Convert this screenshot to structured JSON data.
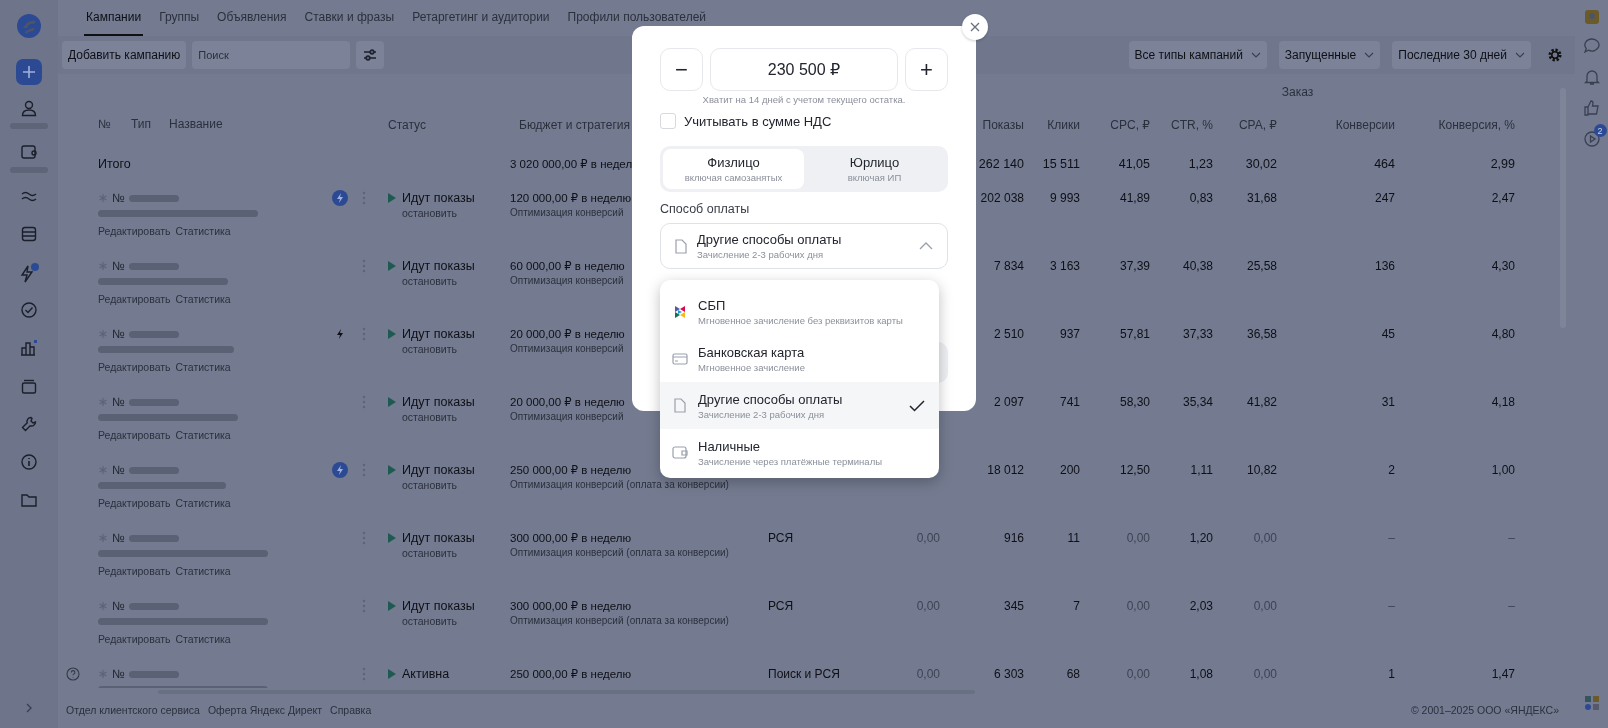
{
  "tabs": [
    {
      "label": "Кампании",
      "selected": true
    },
    {
      "label": "Группы",
      "selected": false
    },
    {
      "label": "Объявления",
      "selected": false
    },
    {
      "label": "Ставки и фразы",
      "selected": false
    },
    {
      "label": "Ретаргетинг и аудитории",
      "selected": false
    },
    {
      "label": "Профили пользователей",
      "selected": false
    }
  ],
  "toolbar": {
    "add_button": "Добавить кампанию",
    "search": {
      "placeholder": "Поиск"
    },
    "filters": [
      "Все типы кампаний",
      "Запущенные",
      "Последние 30 дней"
    ]
  },
  "table": {
    "group_header": "Заказ",
    "name_columns": [
      "№",
      "Тип",
      "Название"
    ],
    "status_column": "Статус",
    "budget_column": "Бюджет и стратегия",
    "metric_columns": [
      "Показы",
      "Клики",
      "CPC, ₽",
      "CTR, %",
      "CPA, ₽",
      "Конверсии",
      "Конверсия, %"
    ],
    "total": {
      "label": "Итого",
      "budget": "3 020 000,00 ₽ в недел",
      "metrics": [
        {
          "text": "262 140",
          "dim": false
        },
        {
          "text": "15 511",
          "dim": false
        },
        {
          "text": "41,05",
          "dim": false
        },
        {
          "text": "1,23",
          "dim": false
        },
        {
          "text": "30,02",
          "dim": false
        },
        {
          "text": "464",
          "dim": false
        },
        {
          "text": "2,99",
          "dim": false
        }
      ]
    },
    "rows": [
      {
        "number": "№",
        "boost": {
          "kind": "filled"
        },
        "help": false,
        "status": "Идут показы",
        "stop": "остановить",
        "budget": "120 000,00 ₽ в неделю",
        "strategy": "Оптимизация конверсий",
        "links": [
          "Редактировать",
          "Статистика"
        ],
        "metrics": [
          {
            "text": "202 038",
            "dim": false
          },
          {
            "text": "9 993",
            "dim": false
          },
          {
            "text": "41,89",
            "dim": false
          },
          {
            "text": "0,83",
            "dim": false
          },
          {
            "text": "31,68",
            "dim": false
          },
          {
            "text": "247",
            "dim": false
          },
          {
            "text": "2,47",
            "dim": false
          }
        ]
      },
      {
        "number": "№",
        "help": false,
        "status": "Идут показы",
        "stop": "остановить",
        "budget": "60 000,00 ₽ в неделю",
        "strategy": "Оптимизация конверсий",
        "links": [
          "Редактировать",
          "Статистика"
        ],
        "metrics": [
          {
            "text": "7 834",
            "dim": false
          },
          {
            "text": "3 163",
            "dim": false
          },
          {
            "text": "37,39",
            "dim": false
          },
          {
            "text": "40,38",
            "dim": false
          },
          {
            "text": "25,58",
            "dim": false
          },
          {
            "text": "136",
            "dim": false
          },
          {
            "text": "4,30",
            "dim": false
          }
        ]
      },
      {
        "number": "№",
        "boost": {
          "kind": "plain"
        },
        "help": false,
        "status": "Идут показы",
        "stop": "остановить",
        "budget": "20 000,00 ₽ в неделю",
        "strategy": "Оптимизация конверсий",
        "links": [
          "Редактировать",
          "Статистика"
        ],
        "metrics": [
          {
            "text": "2 510",
            "dim": false
          },
          {
            "text": "937",
            "dim": false
          },
          {
            "text": "57,81",
            "dim": false
          },
          {
            "text": "37,33",
            "dim": false
          },
          {
            "text": "36,58",
            "dim": false
          },
          {
            "text": "45",
            "dim": false
          },
          {
            "text": "4,80",
            "dim": false
          }
        ]
      },
      {
        "number": "№",
        "help": false,
        "status": "Идут показы",
        "stop": "остановить",
        "budget": "20 000,00 ₽ в неделю",
        "strategy": "Оптимизация конверсий",
        "links": [
          "Редактировать",
          "Статистика"
        ],
        "metrics": [
          {
            "text": "2 097",
            "dim": false
          },
          {
            "text": "741",
            "dim": false
          },
          {
            "text": "58,30",
            "dim": false
          },
          {
            "text": "35,34",
            "dim": false
          },
          {
            "text": "41,82",
            "dim": false
          },
          {
            "text": "31",
            "dim": false
          },
          {
            "text": "4,18",
            "dim": false
          }
        ]
      },
      {
        "number": "№",
        "boost": {
          "kind": "filled"
        },
        "help": false,
        "status": "Идут показы",
        "stop": "остановить",
        "budget": "250 000,00 ₽ в неделю",
        "strategy": "Оптимизация конверсий (оплата за конверсии)",
        "links": [
          "Редактировать",
          "Статистика"
        ],
        "metrics": [
          {
            "text": "18 012",
            "dim": false
          },
          {
            "text": "200",
            "dim": false
          },
          {
            "text": "12,50",
            "dim": false
          },
          {
            "text": "1,11",
            "dim": false
          },
          {
            "text": "10,82",
            "dim": false
          },
          {
            "text": "2",
            "dim": false
          },
          {
            "text": "1,00",
            "dim": false
          }
        ]
      },
      {
        "number": "№",
        "help": false,
        "status": "Идут показы",
        "stop": "остановить",
        "budget": "300 000,00 ₽ в неделю",
        "strategy": "Оптимизация конверсий (оплата за конверсии)",
        "column_5": "РСЯ",
        "column_6": {
          "text": "0,00",
          "dim": true
        },
        "links": [
          "Редактировать",
          "Статистика"
        ],
        "metrics": [
          {
            "text": "916",
            "dim": false
          },
          {
            "text": "11",
            "dim": false
          },
          {
            "text": "0,00",
            "dim": true
          },
          {
            "text": "1,20",
            "dim": false
          },
          {
            "text": "0,00",
            "dim": true
          },
          {
            "text": "–",
            "dim": true
          },
          {
            "text": "–",
            "dim": true
          }
        ]
      },
      {
        "number": "№",
        "help": false,
        "status": "Идут показы",
        "stop": "остановить",
        "budget": "300 000,00 ₽ в неделю",
        "strategy": "Оптимизация конверсий (оплата за конверсии)",
        "column_5": "РСЯ",
        "column_6": {
          "text": "0,00",
          "dim": true
        },
        "links": [
          "Редактировать",
          "Статистика"
        ],
        "metrics": [
          {
            "text": "345",
            "dim": false
          },
          {
            "text": "7",
            "dim": false
          },
          {
            "text": "0,00",
            "dim": true
          },
          {
            "text": "2,03",
            "dim": false
          },
          {
            "text": "0,00",
            "dim": true
          },
          {
            "text": "–",
            "dim": true
          },
          {
            "text": "–",
            "dim": true
          }
        ]
      },
      {
        "number": "№",
        "help": true,
        "status": "Активна",
        "budget": "250 000,00 ₽ в неделю",
        "column_5": "Поиск и РСЯ",
        "column_6": {
          "text": "0,00",
          "dim": true
        },
        "metrics": [
          {
            "text": "6 303",
            "dim": false
          },
          {
            "text": "68",
            "dim": false
          },
          {
            "text": "0,00",
            "dim": true
          },
          {
            "text": "1,08",
            "dim": false
          },
          {
            "text": "0,00",
            "dim": true
          },
          {
            "text": "1",
            "dim": false
          },
          {
            "text": "1,47",
            "dim": false
          }
        ]
      }
    ]
  },
  "right_rail": {
    "badge": "2"
  },
  "footer": {
    "links": [
      "Отдел клиентского сервиса",
      "Оферта Яндекс Директ",
      "Справка"
    ],
    "copyright": "© 2001–2025 ООО «ЯНДЕКС»"
  },
  "payment_dialog": {
    "decrease": "−",
    "amount": "230 500 ₽",
    "increase": "+",
    "hint": "Хватит на 14 дней с учетом текущего остатка.",
    "vat": {
      "label": "Учитывать в сумме НДС",
      "checked": false
    },
    "payer_types": [
      {
        "title": "Физлицо",
        "subtitle": "включая самозанятых",
        "selected": true
      },
      {
        "title": "Юрлицо",
        "subtitle": "включая ИП",
        "selected": false
      }
    ],
    "method_label": "Способ оплаты",
    "method": {
      "title": "Другие способы оплаты",
      "subtitle": "Зачисление 2-3 рабочих дня",
      "expanded": true
    },
    "options": [
      {
        "kind": "sbp",
        "title": "СБП",
        "subtitle": "Мгновенное зачисление без реквизитов карты",
        "selected": false
      },
      {
        "kind": "card",
        "title": "Банковская карта",
        "subtitle": "Мгновенное зачисление",
        "selected": false
      },
      {
        "kind": "document",
        "title": "Другие способы оплаты",
        "subtitle": "Зачисление 2-3 рабочих дня",
        "selected": true
      },
      {
        "kind": "cash",
        "title": "Наличные",
        "subtitle": "Зачисление через платёжные терминалы",
        "selected": false
      }
    ]
  }
}
